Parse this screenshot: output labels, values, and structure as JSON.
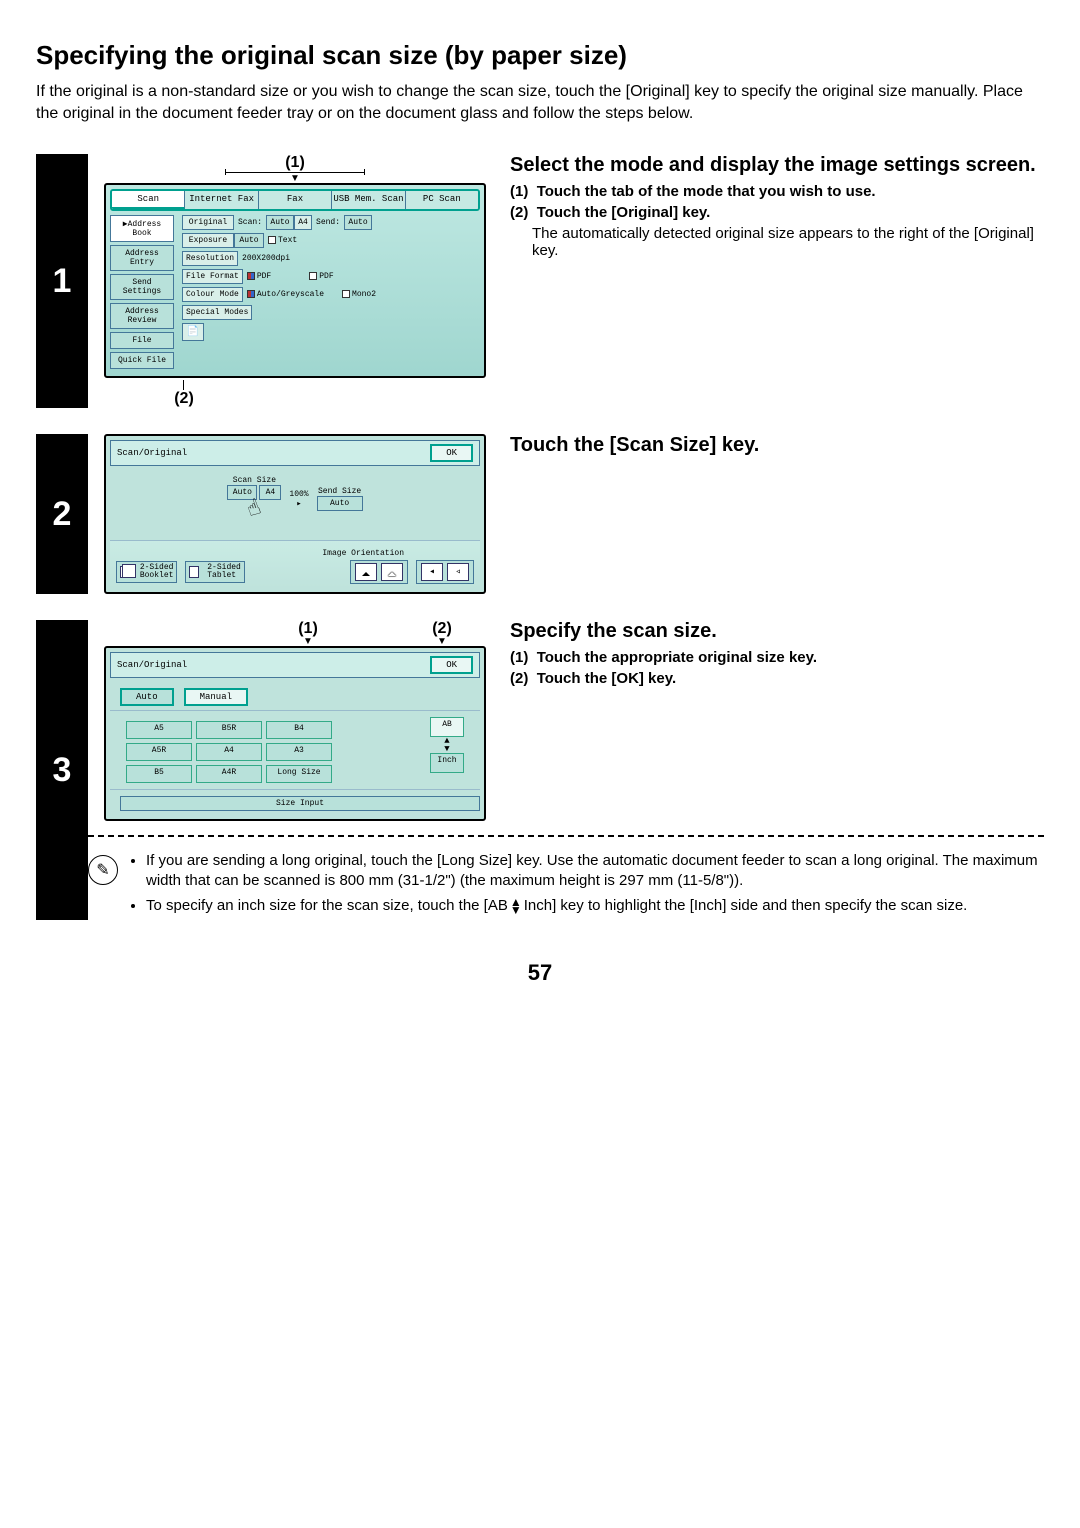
{
  "title": "Specifying the original scan size (by paper size)",
  "intro": "If the original is a non-standard size or you wish to change the scan size, touch the [Original] key to specify the original size manually. Place the original in the document feeder tray or on the document glass and follow the steps below.",
  "page_number": "57",
  "step1": {
    "num": "1",
    "callout1": "(1)",
    "callout2": "(2)",
    "heading": "Select the mode and display the image settings screen.",
    "li1_num": "(1)",
    "li1_txt": "Touch the tab of the mode that you wish to use.",
    "li2_num": "(2)",
    "li2_txt": "Touch the [Original] key.",
    "desc": "The automatically detected original size appears to the right of the [Original] key.",
    "screen": {
      "tabs": [
        "Scan",
        "Internet Fax",
        "Fax",
        "USB Mem. Scan",
        "PC Scan"
      ],
      "side": [
        "Address Book",
        "Address Entry",
        "Send Settings",
        "Address Review",
        "File",
        "Quick File"
      ],
      "rows": {
        "original_btn": "Original",
        "scan_lbl": "Scan:",
        "scan_val": "Auto",
        "scan_size": "A4",
        "send_lbl": "Send:",
        "send_val": "Auto",
        "exposure_btn": "Exposure",
        "exposure_val": "Auto",
        "exposure_type": "Text",
        "resolution_btn": "Resolution",
        "resolution_val": "200X200dpi",
        "fileformat_btn": "File Format",
        "ff_val1": "PDF",
        "ff_val2": "PDF",
        "colour_btn": "Colour Mode",
        "colour_val": "Auto/Greyscale",
        "colour_val2": "Mono2",
        "special_btn": "Special Modes"
      }
    }
  },
  "step2": {
    "num": "2",
    "heading": "Touch the [Scan Size] key.",
    "screen": {
      "header": "Scan/Original",
      "ok": "OK",
      "scan_size_lbl": "Scan Size",
      "pct": "100%",
      "send_size_lbl": "Send Size",
      "scan_auto": "Auto",
      "scan_a4": "A4",
      "send_auto": "Auto",
      "orient": "Image Orientation",
      "b2_1a": "2-Sided",
      "b2_1b": "Booklet",
      "b2_2a": "2-Sided",
      "b2_2b": "Tablet"
    }
  },
  "step3": {
    "num": "3",
    "callout1": "(1)",
    "callout2": "(2)",
    "heading": "Specify the scan size.",
    "li1_num": "(1)",
    "li1_txt": "Touch the appropriate original size key.",
    "li2_num": "(2)",
    "li2_txt": "Touch the [OK] key.",
    "screen": {
      "header": "Scan/Original",
      "ok": "OK",
      "tab_auto": "Auto",
      "tab_manual": "Manual",
      "cursor": "Manual",
      "sizes": [
        "A5",
        "B5R",
        "B4",
        "A5R",
        "A4",
        "A3",
        "B5",
        "A4R",
        "Long Size"
      ],
      "unit_ab": "AB",
      "unit_inch": "Inch",
      "size_input": "Size Input"
    },
    "notes": [
      "If you are sending a long original, touch the [Long Size] key. Use the automatic document feeder to scan a long original. The maximum width that can be scanned is 800 mm (31-1/2\") (the maximum height is 297 mm (11-5/8\")).",
      "To specify an inch size for the scan size, touch the [AB Inch] key to highlight the [Inch] side and then specify the scan size."
    ]
  }
}
